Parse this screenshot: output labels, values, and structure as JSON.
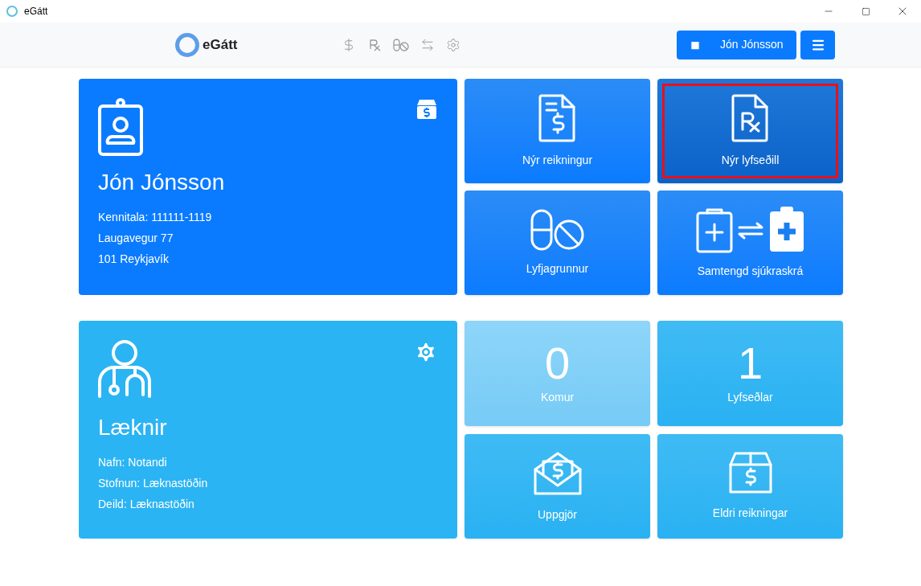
{
  "window": {
    "title": "eGátt"
  },
  "navbar": {
    "brand": "eGátt",
    "user_button": {
      "label": "Jón Jónsson"
    }
  },
  "patient_card": {
    "name": "Jón Jónsson",
    "lines": [
      "Kennitala: 111111-1119",
      "Laugavegur 77",
      "101 Reykjavík"
    ]
  },
  "patient_tiles": [
    {
      "kind": "icon",
      "label": "Nýr reikningur",
      "highlighted": false
    },
    {
      "kind": "icon",
      "label": "Nýr lyfseðill",
      "highlighted": true
    },
    {
      "kind": "icon",
      "label": "Lyfjagrunnur",
      "highlighted": false
    },
    {
      "kind": "icon",
      "label": "Samtengd sjúkraskrá",
      "highlighted": false
    }
  ],
  "doctor_card": {
    "title": "Læknir",
    "lines": [
      "Nafn: Notandi",
      "Stofnun: Læknastöðin",
      "Deild: Læknastöðin"
    ]
  },
  "doctor_tiles": [
    {
      "kind": "count",
      "value": "0",
      "label": "Komur",
      "disabled": true
    },
    {
      "kind": "count",
      "value": "1",
      "label": "Lyfseðlar",
      "disabled": false
    },
    {
      "kind": "icon",
      "label": "Uppgjör",
      "disabled": false
    },
    {
      "kind": "icon",
      "label": "Eldri reikningar",
      "disabled": false
    }
  ]
}
